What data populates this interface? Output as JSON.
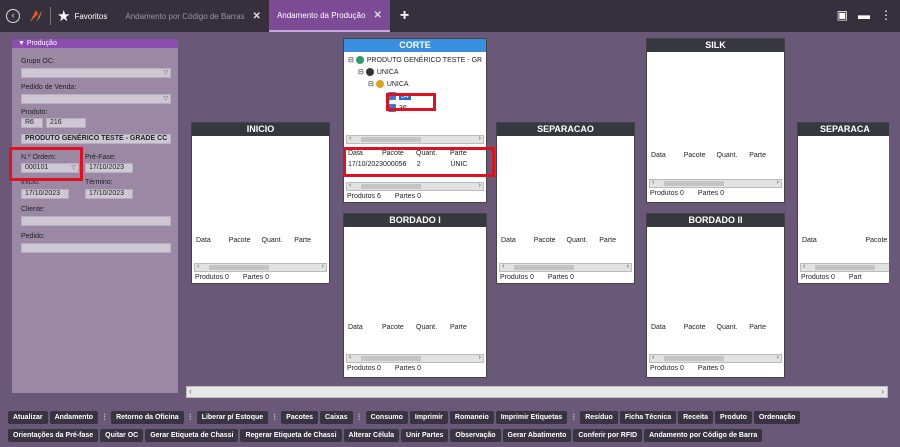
{
  "topbar": {
    "favorites_label": "Favoritos",
    "tabs": [
      {
        "label": "Andamento por Código de Barras"
      },
      {
        "label": "Andamento da Produção"
      }
    ]
  },
  "filter": {
    "section_title": "▼ Produção",
    "grupo_oc_label": "Grupo OC:",
    "grupo_oc_value": "",
    "pedido_venda_label": "Pedido de Venda:",
    "pedido_venda_value": "",
    "produto_label": "Produto:",
    "produto_prefix": "R6",
    "produto_code": "216",
    "produto_name": "PRODUTO GENÉRICO TESTE - GRADE CC",
    "ordem_label": "N.º Ordem:",
    "ordem_value": "000101",
    "prefase_label": "Pré-Fase:",
    "prefase_value": "17/10/2023",
    "inicio_label": "Início:",
    "inicio_value": "17/10/2023",
    "termino_label": "Término:",
    "termino_value": "17/10/2023",
    "cliente_label": "Cliente:",
    "cliente_value": "",
    "pedido_label": "Pedido:",
    "pedido_value": ""
  },
  "columns": {
    "data": "Data",
    "pacote": "Pacote",
    "quant": "Quant.",
    "partes": "Parte"
  },
  "footer_labels": {
    "produtos": "Produtos",
    "partes": "Partes"
  },
  "stages": {
    "inicio": {
      "title": "INICIO",
      "produtos": "0",
      "partes": "0"
    },
    "corte": {
      "title": "CORTE",
      "tree": [
        "PRODUTO GENÉRICO TESTE - GR",
        "UNICA",
        "UNICA",
        "34",
        "36"
      ],
      "row": {
        "data": "17/10/2023",
        "pacote": "000056",
        "quant": "2",
        "partes": "ÚNIC"
      },
      "produtos": "6",
      "partes": "0"
    },
    "bordado1": {
      "title": "BORDADO I",
      "produtos": "0",
      "partes": "0"
    },
    "separacao": {
      "title": "SEPARACAO",
      "produtos": "0",
      "partes": "0"
    },
    "silk": {
      "title": "SILK",
      "produtos": "0",
      "partes": "0"
    },
    "bordado2": {
      "title": "BORDADO II",
      "produtos": "0",
      "partes": "0"
    },
    "separacao2": {
      "title": "SEPARACA",
      "produtos": "0",
      "partes": "Part"
    }
  },
  "buttons_row1": [
    "Atualizar",
    "Andamento",
    "Retorno da Oficina",
    "Liberar p/ Estoque",
    "Pacotes",
    "Caixas",
    "Consumo",
    "Imprimir",
    "Romaneio",
    "Imprimir Etiquetas",
    "Resíduo",
    "Ficha Técnica",
    "Receita",
    "Produto",
    "Ordenação"
  ],
  "buttons_row2": [
    "Orientações da Pré-fase",
    "Quitar OC",
    "Gerar Etiqueta de Chassi",
    "Regerar Etiqueta de Chassi",
    "Alterar Célula",
    "Unir Partes",
    "Observação",
    "Gerar Abatimento",
    "Conferir por RFID",
    "Andamento por Código de Barra"
  ],
  "colors": {
    "accent": "#8d4cb0",
    "highlight": "#e01020",
    "corte_header": "#3b8fe0"
  }
}
